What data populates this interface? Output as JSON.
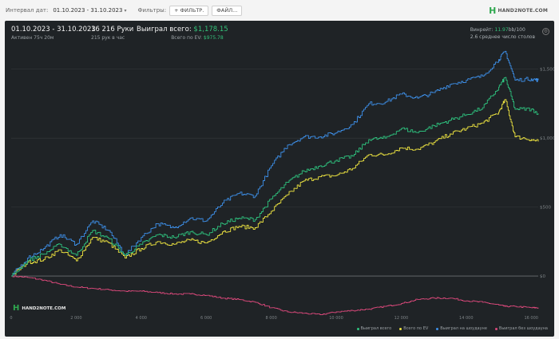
{
  "toolbar": {
    "interval_label": "Интервал дат:",
    "date_range": "01.10.2023 - 31.10.2023",
    "filters_label": "Фильтры:",
    "filter_button": "ФИЛЬТР.",
    "file_button": "ФАЙЛ..."
  },
  "brand": {
    "mark": "H",
    "name": "HAND2NOTE.COM"
  },
  "summary": {
    "period": "01.10.2023 - 31.10.2023",
    "active": "Активен 75ч 20м",
    "hands": "16 216 Руки",
    "hands_per_hour": "215 рук в час",
    "won_total_label": "Выиграл всего:",
    "won_total_value": "$1,178.15",
    "ev_total_label": "Всего по EV:",
    "ev_total_value": "$975.78",
    "winrate_label": "Винрейт:",
    "winrate_value": "11.97",
    "winrate_unit": "bb/100",
    "avg_tables": "2.6 среднее число столов"
  },
  "icons": {
    "settings": "gear-icon",
    "filter_add": "plus-icon",
    "date_dropdown": "chevron-down-icon"
  },
  "colors": {
    "panel_bg": "#1f2326",
    "won_total": "#2ec27e",
    "ev_total": "#f0e640",
    "won_showdown": "#3d8fe8",
    "won_no_showdown": "#d9487a",
    "accent": "#2fa84f"
  },
  "chart_data": {
    "type": "line",
    "xlabel": "",
    "ylabel": "",
    "x_ticks": [
      "0",
      "2 000",
      "4 000",
      "6 000",
      "8 000",
      "10 000",
      "12 000",
      "14 000",
      "16 000"
    ],
    "y_ticks": [
      "$0",
      "$500",
      "$1,000",
      "$1,500"
    ],
    "xlim": [
      0,
      16216
    ],
    "ylim": [
      -260,
      1620
    ],
    "grid": true,
    "legend_position": "bottom-right",
    "x": [
      0,
      500,
      1000,
      1500,
      2000,
      2500,
      3000,
      3500,
      4000,
      4500,
      5000,
      5500,
      6000,
      6500,
      7000,
      7500,
      8000,
      8500,
      9000,
      9500,
      10000,
      10500,
      11000,
      11500,
      12000,
      12500,
      13000,
      13500,
      14000,
      14500,
      15000,
      15200,
      15500,
      16000,
      16216
    ],
    "series": [
      {
        "name": "Выиграл на шоудауне",
        "color": "#3d8fe8",
        "values": [
          0,
          130,
          200,
          300,
          230,
          400,
          330,
          150,
          280,
          380,
          350,
          420,
          400,
          530,
          600,
          580,
          800,
          950,
          1010,
          1010,
          1040,
          1100,
          1250,
          1260,
          1320,
          1290,
          1330,
          1390,
          1420,
          1450,
          1570,
          1630,
          1420,
          1430,
          1420
        ]
      },
      {
        "name": "Выиграл всего",
        "color": "#2ec27e",
        "values": [
          0,
          110,
          160,
          230,
          150,
          330,
          270,
          150,
          230,
          300,
          280,
          320,
          300,
          380,
          420,
          410,
          560,
          680,
          760,
          800,
          840,
          870,
          990,
          1000,
          1070,
          1040,
          1090,
          1130,
          1170,
          1220,
          1370,
          1440,
          1210,
          1210,
          1180
        ]
      },
      {
        "name": "Всего по EV",
        "color": "#f0e640",
        "values": [
          0,
          100,
          120,
          190,
          110,
          280,
          240,
          130,
          200,
          250,
          230,
          260,
          240,
          320,
          360,
          350,
          470,
          590,
          690,
          720,
          730,
          780,
          880,
          880,
          930,
          920,
          970,
          1030,
          1070,
          1110,
          1190,
          1280,
          1010,
          990,
          975
        ]
      },
      {
        "name": "Выиграл без шоудауна",
        "color": "#d9487a",
        "values": [
          0,
          -10,
          -30,
          -60,
          -80,
          -90,
          -100,
          -110,
          -110,
          -120,
          -130,
          -130,
          -140,
          -160,
          -170,
          -190,
          -230,
          -260,
          -270,
          -280,
          -260,
          -250,
          -240,
          -220,
          -200,
          -170,
          -160,
          -160,
          -180,
          -190,
          -210,
          -220,
          -220,
          -230,
          -230
        ]
      }
    ]
  },
  "legend": [
    {
      "label": "Выиграл всего",
      "color": "#2ec27e"
    },
    {
      "label": "Всего по EV",
      "color": "#f0e640"
    },
    {
      "label": "Выиграл на шоудауне",
      "color": "#3d8fe8"
    },
    {
      "label": "Выиграл без шоудауна",
      "color": "#d9487a"
    }
  ]
}
